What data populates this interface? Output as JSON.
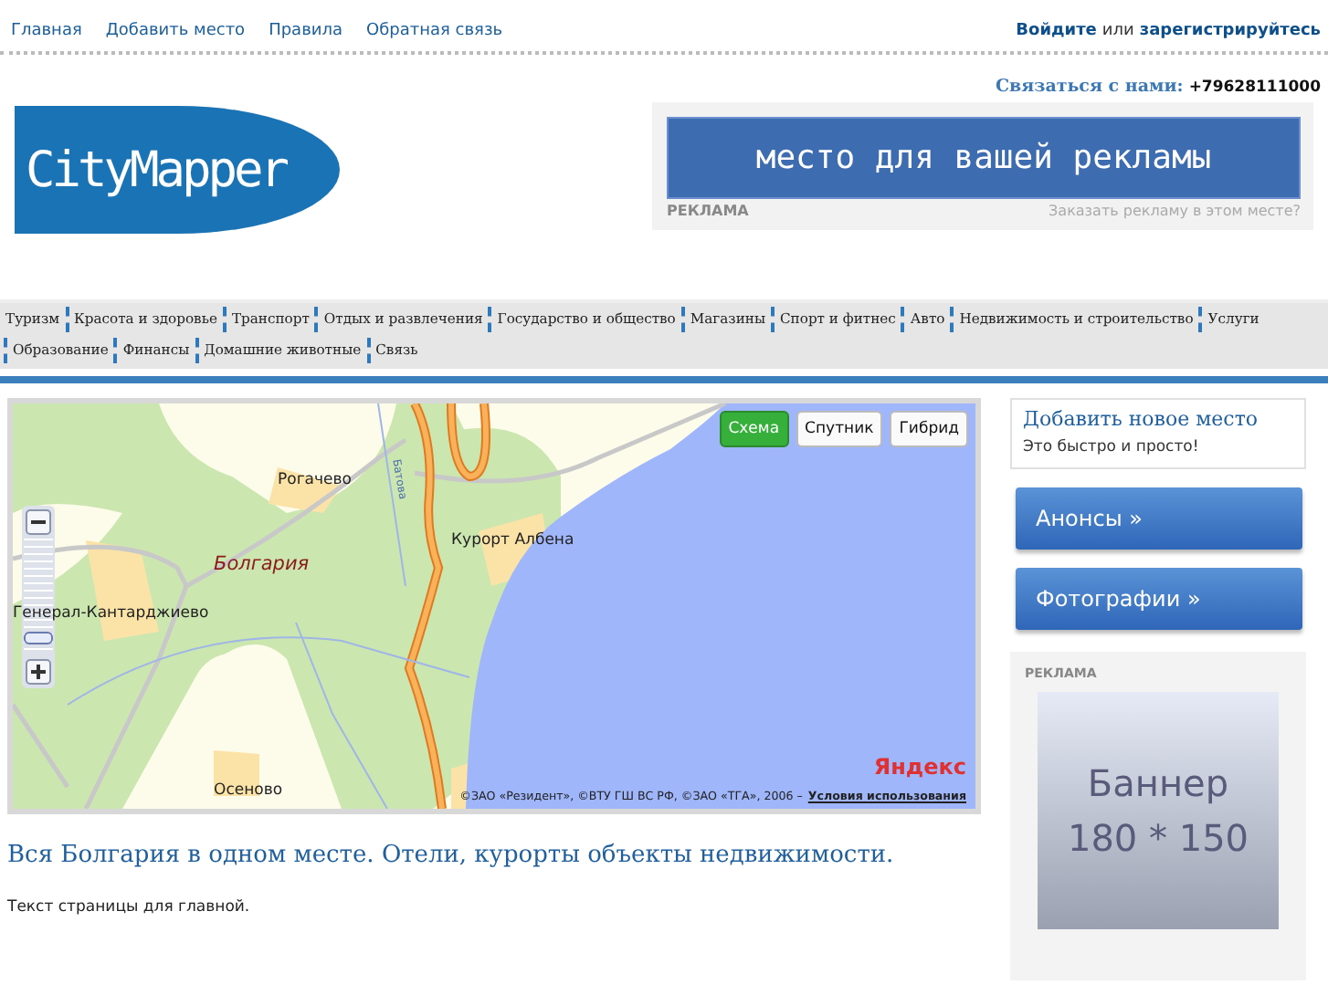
{
  "top_nav": {
    "links": [
      "Главная",
      "Добавить место",
      "Правила",
      "Обратная связь"
    ]
  },
  "auth": {
    "login": "Войдите",
    "or": "или",
    "register": "зарегистрируйтесь"
  },
  "contact": {
    "label": "Связаться с нами:",
    "phone": "+79628111000"
  },
  "logo": {
    "text": "CityMapper"
  },
  "top_ad": {
    "text": "место для вашей рекламы",
    "label": "РЕКЛАМА",
    "link": "Заказать рекламу в этом месте?"
  },
  "categories": [
    "Туризм",
    "Красота и здоровье",
    "Транспорт",
    "Отдых и развлечения",
    "Государство и общество",
    "Магазины",
    "Спорт и фитнес",
    "Авто",
    "Недвижимость и строительство",
    "Услуги",
    "Образование",
    "Финансы",
    "Домашние животные",
    "Связь"
  ],
  "map": {
    "modes": [
      {
        "label": "Схема",
        "selected": true
      },
      {
        "label": "Спутник",
        "selected": false
      },
      {
        "label": "Гибрид",
        "selected": false
      }
    ],
    "zoom": {
      "level": 0.1
    },
    "places": [
      {
        "kind": "town",
        "text": "Рогачево"
      },
      {
        "kind": "town",
        "text": "Курорт Албена"
      },
      {
        "kind": "region",
        "text": "Болгария"
      },
      {
        "kind": "town",
        "text": "Генерал-Кантарджиево"
      },
      {
        "kind": "town",
        "text": "Осеново"
      },
      {
        "kind": "river",
        "text": "Батова"
      }
    ],
    "brand": "Яндекс",
    "copyright": "©ЗАО «Резидент», ©ВТУ ГШ ВС РФ, ©ЗАО «ТГА», 2006 –",
    "terms": "Условия использования"
  },
  "main": {
    "title": "Вся Болгария в одном месте. Отели, курорты объекты недвижимости.",
    "text": "Текст страницы для главной."
  },
  "sidebar": {
    "add_place": {
      "title": "Добавить новое место",
      "subtitle": "Это быстро и просто!"
    },
    "buttons": [
      "Анонсы »",
      "Фотографии »"
    ],
    "ad": {
      "label": "РЕКЛАМА",
      "banner": [
        "Баннер",
        "180 * 150"
      ]
    }
  }
}
